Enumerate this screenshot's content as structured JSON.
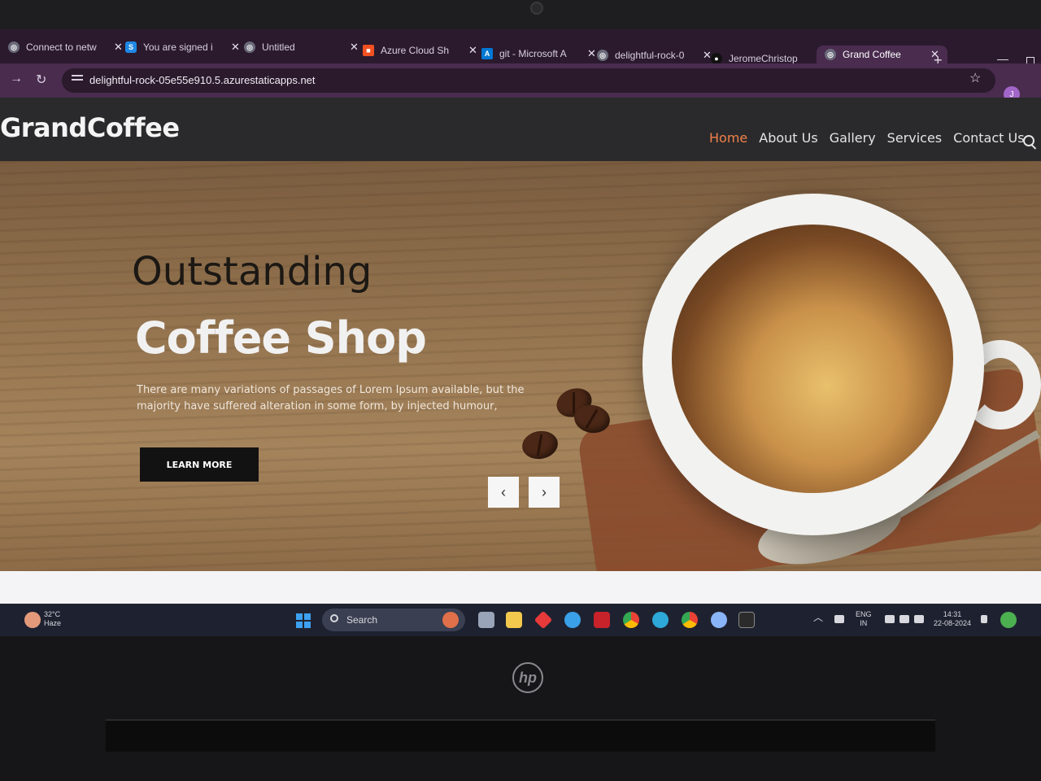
{
  "browser": {
    "tabs": [
      {
        "label": "Connect to netw",
        "icon": "globe-icon",
        "active": false
      },
      {
        "label": "You are signed i",
        "icon": "s-icon",
        "active": false
      },
      {
        "label": "Untitled",
        "icon": "globe-icon",
        "active": false
      },
      {
        "label": "Azure Cloud Sh",
        "icon": "windows-icon",
        "active": false
      },
      {
        "label": "git - Microsoft A",
        "icon": "azure-icon",
        "active": false
      },
      {
        "label": "delightful-rock-0",
        "icon": "globe-icon",
        "active": false
      },
      {
        "label": "JeromeChristop",
        "icon": "github-icon",
        "active": false
      },
      {
        "label": "Grand Coffee",
        "icon": "globe-icon",
        "active": true
      }
    ],
    "url": "delightful-rock-05e55e910.5.azurestaticapps.net",
    "profile_initial": "J"
  },
  "site": {
    "logo": "GrandCoffee",
    "nav": [
      {
        "label": "Home",
        "active": true
      },
      {
        "label": "About Us",
        "active": false
      },
      {
        "label": "Gallery",
        "active": false
      },
      {
        "label": "Services",
        "active": false
      },
      {
        "label": "Contact Us",
        "active": false
      }
    ],
    "hero": {
      "line1": "Outstanding",
      "line2": "Coffee Shop",
      "description": "There are many variations of passages of Lorem Ipsum available, but the majority have suffered alteration in some form, by injected humour,",
      "button": "LEARN MORE",
      "prev_arrow": "‹",
      "next_arrow": "›"
    }
  },
  "taskbar": {
    "weather_temp": "32°C",
    "weather_desc": "Haze",
    "search_placeholder": "Search",
    "lang_top": "ENG",
    "lang_bottom": "IN",
    "time": "14:31",
    "date": "22-08-2024"
  },
  "device": {
    "brand": "hp"
  },
  "colors": {
    "browser_frame": "#4a2c4f",
    "header_bg": "#2a2a2c",
    "nav_active": "#f0804a",
    "button_bg": "#121212"
  }
}
